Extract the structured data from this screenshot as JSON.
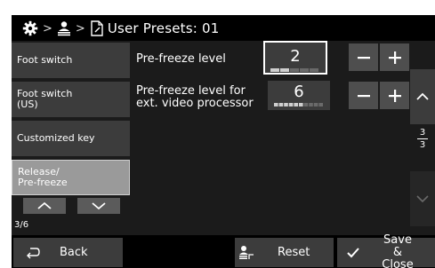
{
  "header": {
    "title": "User Presets: 01",
    "separator": ">",
    "icons": [
      "gear-icon",
      "user-icon",
      "document-icon"
    ]
  },
  "sidebar": {
    "items": [
      {
        "label": "Foot switch",
        "active": false
      },
      {
        "label": "Foot switch (US)",
        "active": false
      },
      {
        "label": "Customized key",
        "active": false
      },
      {
        "label": "Release/ Pre-freeze",
        "active": true
      }
    ],
    "page_indicator": "3/6"
  },
  "settings": [
    {
      "label": "Pre-freeze level",
      "value": "2",
      "level_fraction": 0.3,
      "selected": true
    },
    {
      "label": "Pre-freeze level for ext. video processor",
      "value": "6",
      "level_fraction": 0.6,
      "selected": false
    }
  ],
  "scroll": {
    "page_current": "3",
    "page_total": "3"
  },
  "footer": {
    "back_label": "Back",
    "reset_label": "Reset",
    "save_close_label": "Save & Close"
  },
  "colors": {
    "background": "#1b1b1b",
    "button": "#3c3c3c",
    "active_item": "#9a9a9a"
  }
}
